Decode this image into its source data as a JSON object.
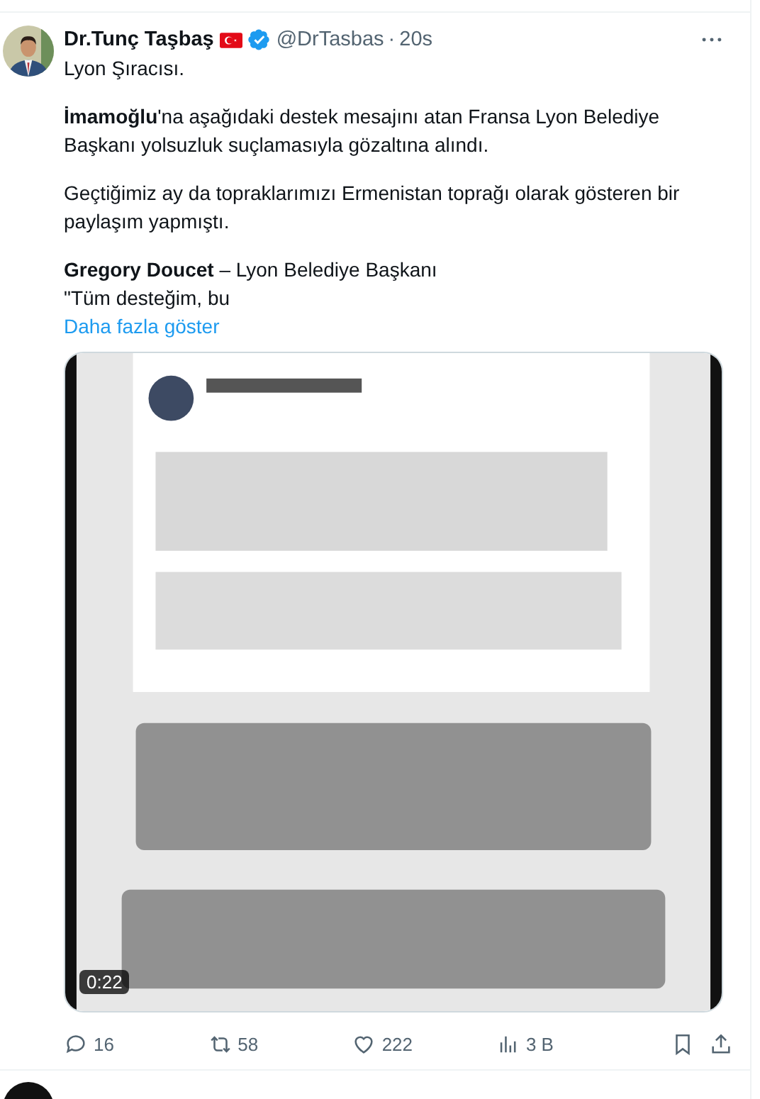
{
  "tweet": {
    "author": {
      "name": "Dr.Tunç Taşbaş",
      "handle": "@DrTasbas",
      "separator": "·",
      "time": "20s",
      "verified": true
    },
    "paragraphs": [
      "Lyon Şıracısı.",
      "**İmamoğlu**'na aşağıdaki destek mesajını atan Fransa Lyon Belediye Başkanı yolsuzluk suçlamasıyla gözaltına alındı.",
      "Geçtiğimiz ay da topraklarımızı Ermenistan toprağı olarak gösteren bir paylaşım yapmıştı.",
      "**Gregory Doucet** – Lyon Belediye Başkanı\n\"Tüm desteğim, bu"
    ],
    "show_more": "Daha fazla göster",
    "video": {
      "kind": "picture",
      "duration": "0:22"
    },
    "actions": [
      {
        "kind": "reply",
        "count": "16"
      },
      {
        "kind": "repost",
        "count": "58"
      },
      {
        "kind": "like",
        "count": "222"
      },
      {
        "kind": "views",
        "count": "3 B"
      },
      {
        "kind": "bookmark"
      },
      {
        "kind": "share"
      }
    ]
  }
}
